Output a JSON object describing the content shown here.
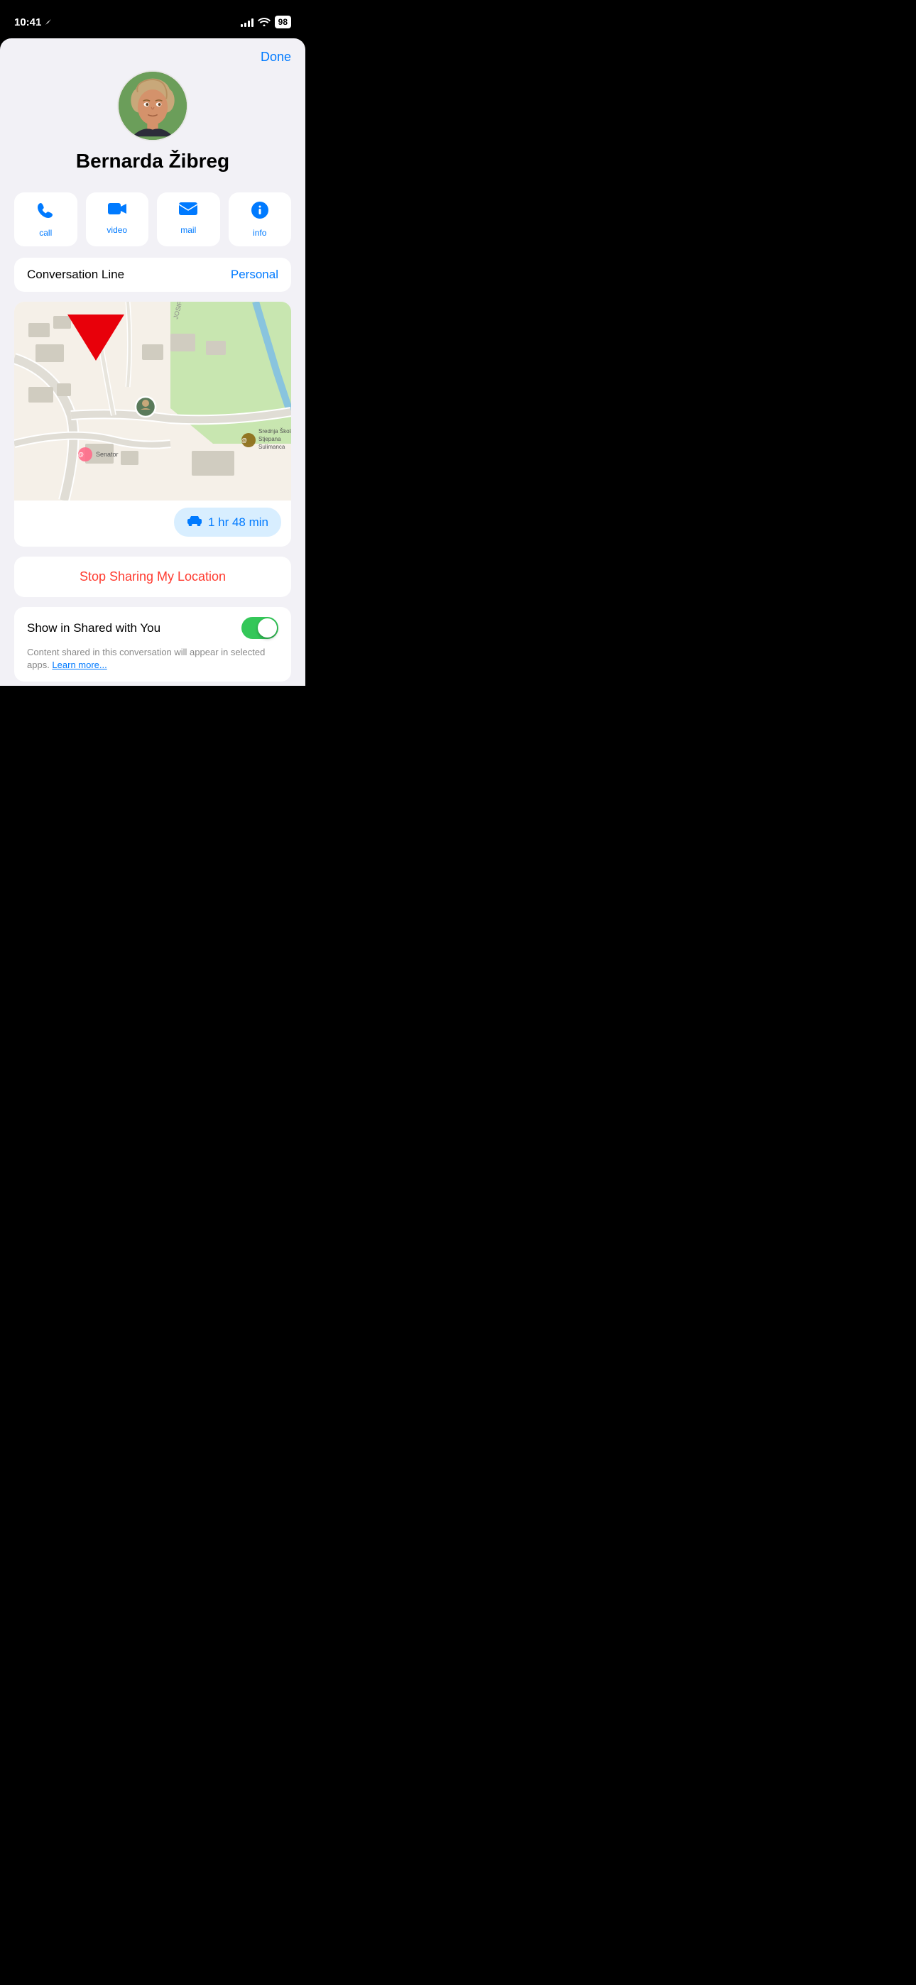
{
  "status": {
    "time": "10:41",
    "battery": "98"
  },
  "header": {
    "done_label": "Done"
  },
  "contact": {
    "name": "Bernarda Žibreg"
  },
  "actions": [
    {
      "id": "call",
      "label": "call"
    },
    {
      "id": "video",
      "label": "video"
    },
    {
      "id": "mail",
      "label": "mail"
    },
    {
      "id": "info",
      "label": "info"
    }
  ],
  "conversation": {
    "label": "Conversation Line",
    "value": "Personal"
  },
  "map": {
    "eta_label": "1 hr 48 min",
    "address": ""
  },
  "stop_sharing": {
    "label": "Stop Sharing My Location"
  },
  "shared_with_you": {
    "label": "Show in Shared with You",
    "description": "Content shared in this conversation will appear in selected apps. ",
    "learn_more": "Learn more..."
  }
}
